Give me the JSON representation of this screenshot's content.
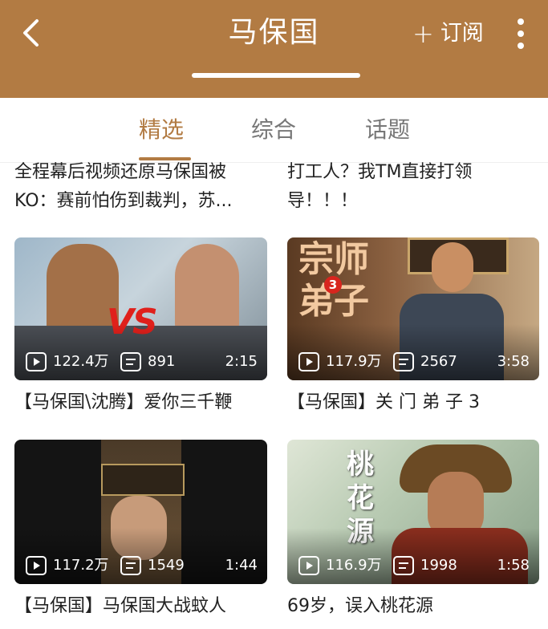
{
  "header": {
    "title": "马保国",
    "subscribe_plus": "+",
    "subscribe_label": "订阅"
  },
  "tabs": [
    {
      "label": "精选",
      "active": true
    },
    {
      "label": "综合",
      "active": false
    },
    {
      "label": "话题",
      "active": false
    }
  ],
  "top_titles": [
    "全程幕后视频还原马保国被\nKO：赛前怕伤到裁判，苏...",
    "打工人？我TM直接打领\n导！！！"
  ],
  "videos": [
    {
      "title": "【马保国\\沈腾】爱你三千鞭",
      "views": "122.4万",
      "danmaku": "891",
      "duration": "2:15",
      "thumb_text": "VS"
    },
    {
      "title": "【马保国】关 门 弟 子 3",
      "views": "117.9万",
      "danmaku": "2567",
      "duration": "3:58",
      "thumb_text": [
        "宗",
        "师",
        "弟",
        "子"
      ],
      "thumb_badge": "3"
    },
    {
      "title": "【马保国】马保国大战蚊人",
      "views": "117.2万",
      "danmaku": "1549",
      "duration": "1:44"
    },
    {
      "title": "69岁，误入桃花源",
      "views": "116.9万",
      "danmaku": "1998",
      "duration": "1:58",
      "thumb_text": [
        "桃",
        "花",
        "源"
      ]
    }
  ],
  "colors": {
    "header": "#b27b43",
    "accent": "#b27b43"
  },
  "icons": [
    "back-arrow-icon",
    "more-vertical-icon",
    "play-icon",
    "danmaku-icon"
  ]
}
